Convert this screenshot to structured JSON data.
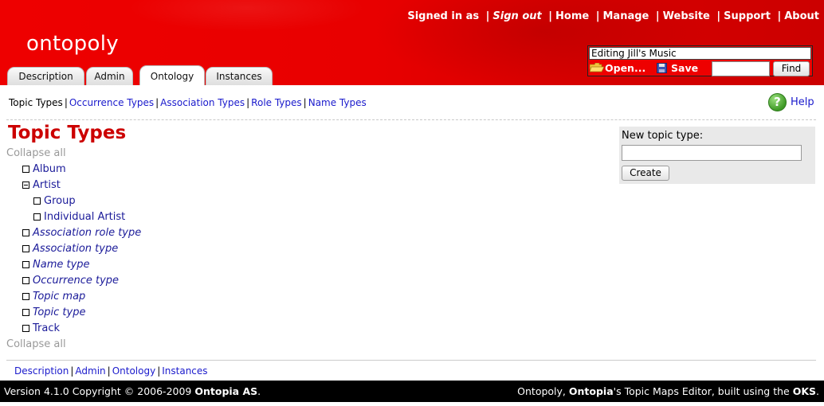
{
  "header": {
    "logo": "ontopoly",
    "topnav": {
      "signed_in": "Signed in as",
      "sign_out": "Sign out",
      "links": [
        "Home",
        "Manage",
        "Website",
        "Support",
        "About"
      ]
    },
    "tabs": [
      "Description",
      "Admin",
      "Ontology",
      "Instances"
    ],
    "active_tab": "Ontology",
    "topicmap": {
      "editing_value": "Editing Jill's Music",
      "open_label": "Open...",
      "save_label": "Save",
      "search_value": "",
      "find_label": "Find"
    },
    "colors": {
      "header_red": "#ee0000",
      "link_blue": "#1a1acc",
      "title_red": "#cc0000"
    }
  },
  "subnav": {
    "items": [
      "Topic Types",
      "Occurrence Types",
      "Association Types",
      "Role Types",
      "Name Types"
    ],
    "current": "Topic Types",
    "help_label": "Help",
    "help_icon": "help-icon"
  },
  "main": {
    "title": "Topic Types",
    "collapse_all": "Collapse all",
    "tree": [
      {
        "label": "Album",
        "italic": false,
        "expanded": false
      },
      {
        "label": "Artist",
        "italic": false,
        "expanded": true
      },
      {
        "label": "Group",
        "italic": false,
        "expanded": false
      },
      {
        "label": "Individual Artist",
        "italic": false,
        "expanded": false
      },
      {
        "label": "Association role type",
        "italic": true,
        "expanded": false
      },
      {
        "label": "Association type",
        "italic": true,
        "expanded": false
      },
      {
        "label": "Name type",
        "italic": true,
        "expanded": false
      },
      {
        "label": "Occurrence type",
        "italic": true,
        "expanded": false
      },
      {
        "label": "Topic map",
        "italic": true,
        "expanded": false
      },
      {
        "label": "Topic type",
        "italic": true,
        "expanded": false
      },
      {
        "label": "Track",
        "italic": false,
        "expanded": false
      }
    ],
    "new_topic": {
      "label": "New topic type:",
      "value": "",
      "create_label": "Create"
    }
  },
  "bottomnav": {
    "items": [
      "Description",
      "Admin",
      "Ontology",
      "Instances"
    ]
  },
  "footer": {
    "left_prefix": "Version 4.1.0 Copyright © 2006-2009 ",
    "left_company": "Ontopia AS",
    "left_suffix": ".",
    "right_a": "Ontopoly, ",
    "right_b": "Ontopia",
    "right_c": "'s Topic Maps Editor, built using the ",
    "right_d": "OKS",
    "right_e": "."
  }
}
